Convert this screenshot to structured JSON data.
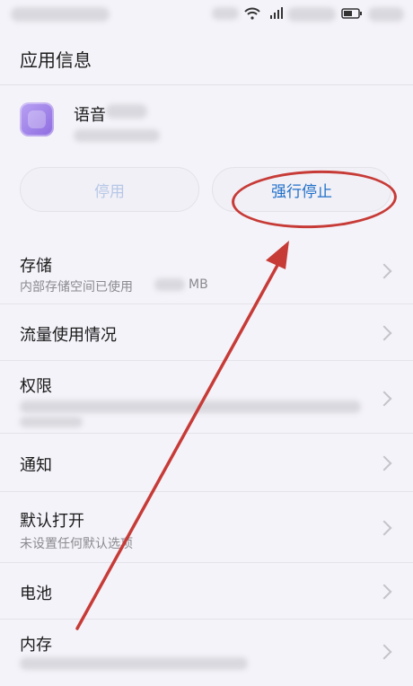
{
  "header": {
    "title": "应用信息"
  },
  "app": {
    "name": "语音"
  },
  "buttons": {
    "disable_label": "停用",
    "force_stop_label": "强行停止"
  },
  "settings": [
    {
      "title": "存储",
      "subtitle_prefix": "内部存储空间已使用",
      "subtitle_suffix": "MB"
    },
    {
      "title": "流量使用情况"
    },
    {
      "title": "权限"
    },
    {
      "title": "通知"
    },
    {
      "title": "默认打开",
      "subtitle": "未设置任何默认选项"
    },
    {
      "title": "电池"
    },
    {
      "title": "内存"
    }
  ],
  "colors": {
    "accent_blue": "#1f6fc9",
    "annotation_red": "#c73b37",
    "app_icon_purple": "#a088ea"
  }
}
